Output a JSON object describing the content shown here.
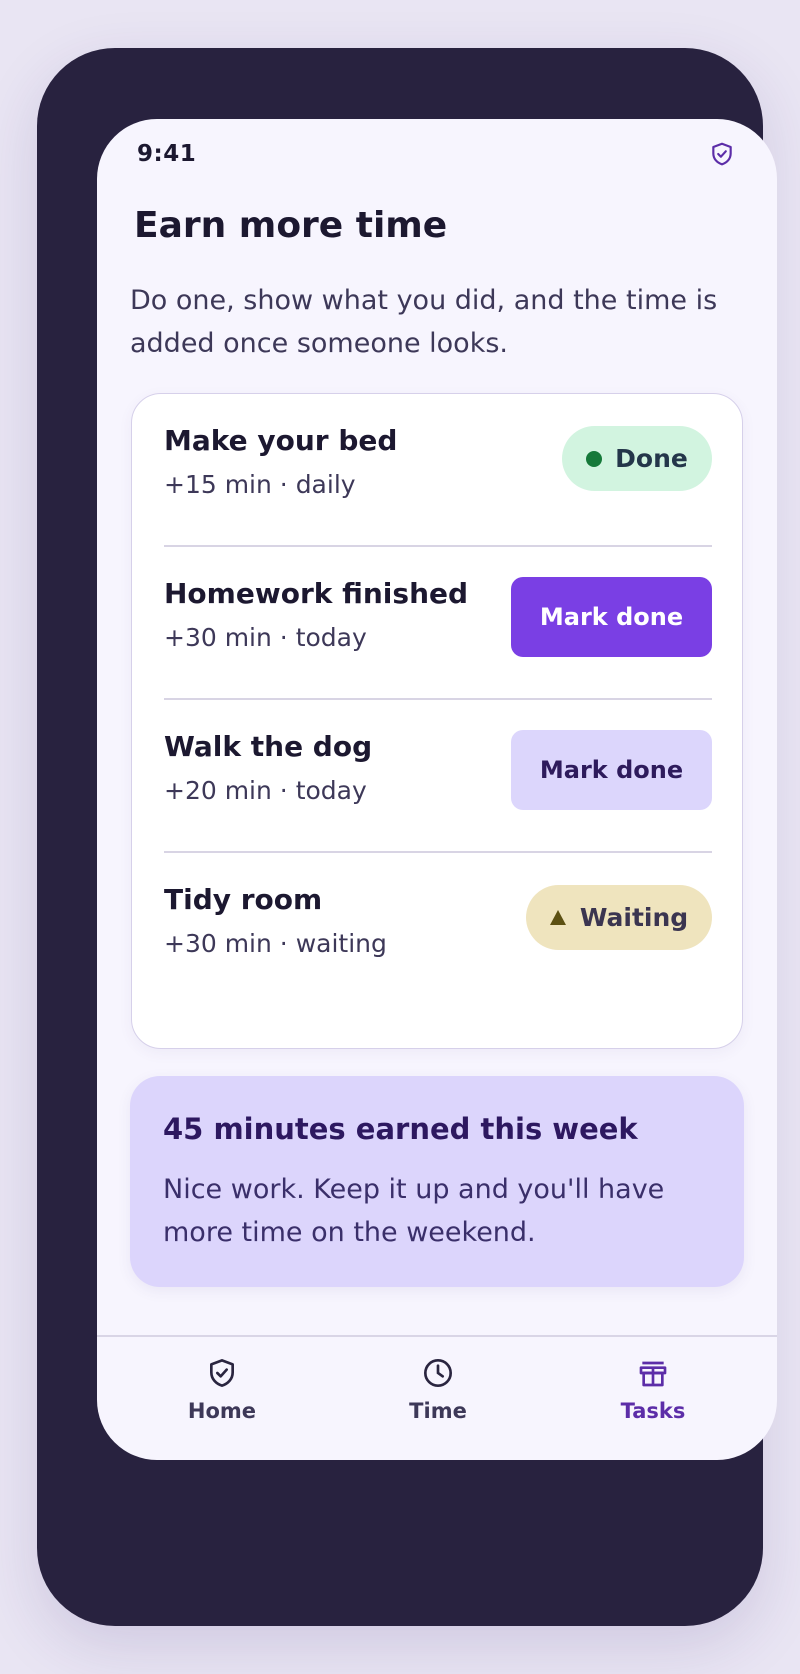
{
  "status_bar": {
    "time": "9:41",
    "icon": "shield-check-icon"
  },
  "header": {
    "title": "Earn more time",
    "subtitle": "Do one, show what you did, and the time is added once someone looks."
  },
  "tasks": [
    {
      "name": "Make your bed",
      "meta": "+15 min · daily",
      "state": "done",
      "action_label": "Done"
    },
    {
      "name": "Homework finished",
      "meta": "+30 min · today",
      "state": "todo-primary",
      "action_label": "Mark done"
    },
    {
      "name": "Walk the dog",
      "meta": "+20 min · today",
      "state": "todo",
      "action_label": "Mark done"
    },
    {
      "name": "Tidy room",
      "meta": "+30 min · waiting",
      "state": "waiting",
      "action_label": "Waiting"
    }
  ],
  "summary": {
    "title": "45 minutes earned this week",
    "text": "Nice work. Keep it up and you'll have more time on the weekend."
  },
  "nav": {
    "items": [
      {
        "label": "Home",
        "icon": "shield-check-icon",
        "active": false
      },
      {
        "label": "Time",
        "icon": "clock-icon",
        "active": false
      },
      {
        "label": "Tasks",
        "icon": "gift-icon",
        "active": true
      }
    ]
  },
  "colors": {
    "accent": "#7a3fe4",
    "done": "#16793a",
    "waiting": "#efe4be",
    "frame": "#28223f"
  }
}
